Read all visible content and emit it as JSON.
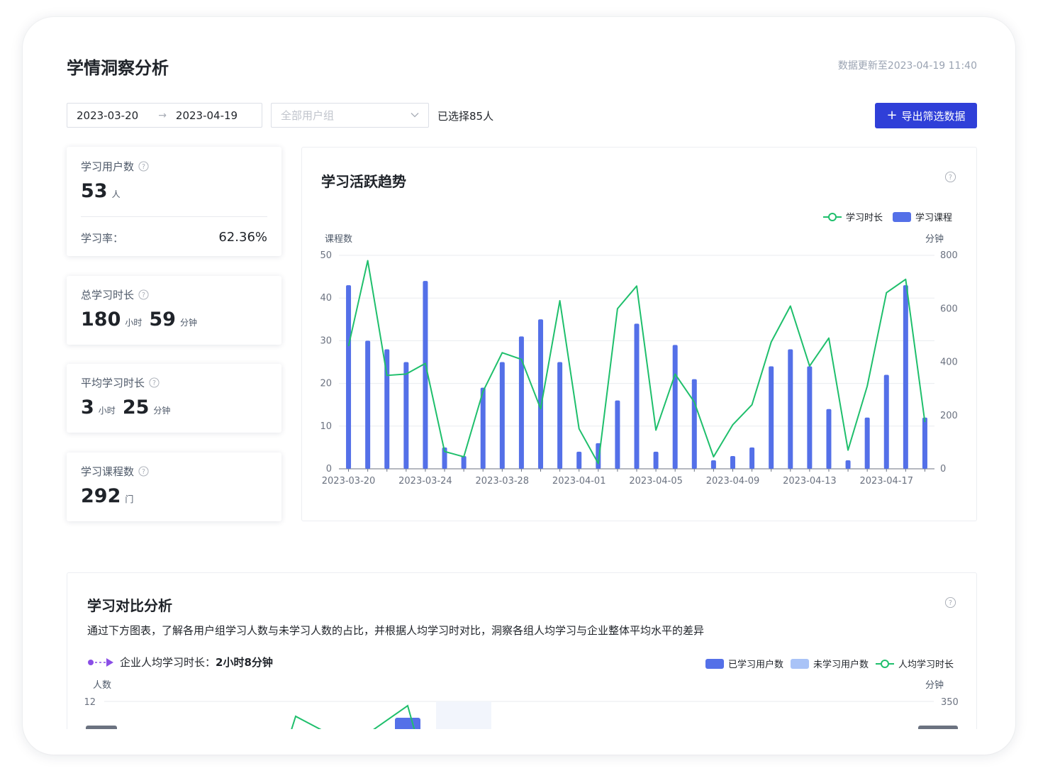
{
  "header": {
    "title": "学情洞察分析",
    "update_time": "数据更新至2023-04-19 11:40"
  },
  "filters": {
    "date_start": "2023-03-20",
    "date_arrow": "→",
    "date_end": "2023-04-19",
    "group_placeholder": "全部用户组",
    "selected_count": "已选择85人",
    "export_label": "导出筛选数据"
  },
  "stats": {
    "users": {
      "label": "学习用户数",
      "value": "53",
      "unit": "人",
      "rate_label": "学习率：",
      "rate_value": "62.36%"
    },
    "total_time": {
      "label": "总学习时长",
      "hours": "180",
      "hours_unit": "小时",
      "minutes": "59",
      "minutes_unit": "分钟"
    },
    "avg_time": {
      "label": "平均学习时长",
      "hours": "3",
      "hours_unit": "小时",
      "minutes": "25",
      "minutes_unit": "分钟"
    },
    "courses": {
      "label": "学习课程数",
      "value": "292",
      "unit": "门"
    }
  },
  "trend": {
    "title": "学习活跃趋势"
  },
  "chart_data": [
    {
      "type": "bar",
      "title": "学习活跃趋势",
      "ylabel": "课程数",
      "y2label": "分钟",
      "ylim": [
        0,
        50
      ],
      "y2lim": [
        0,
        800
      ],
      "yticks": [
        "0",
        "10",
        "20",
        "30",
        "40",
        "50"
      ],
      "y2ticks": [
        "0",
        "200",
        "400",
        "600",
        "800"
      ],
      "xticks": [
        "2023-03-20",
        "2023-03-24",
        "2023-03-28",
        "2023-04-01",
        "2023-04-05",
        "2023-04-09",
        "2023-04-13",
        "2023-04-17"
      ],
      "legend": "top-right",
      "categories": [
        "2023-03-20",
        "2023-03-21",
        "2023-03-22",
        "2023-03-23",
        "2023-03-24",
        "2023-03-25",
        "2023-03-26",
        "2023-03-27",
        "2023-03-28",
        "2023-03-29",
        "2023-03-30",
        "2023-03-31",
        "2023-04-01",
        "2023-04-02",
        "2023-04-03",
        "2023-04-04",
        "2023-04-05",
        "2023-04-06",
        "2023-04-07",
        "2023-04-08",
        "2023-04-09",
        "2023-04-10",
        "2023-04-11",
        "2023-04-12",
        "2023-04-13",
        "2023-04-14",
        "2023-04-15",
        "2023-04-16",
        "2023-04-17",
        "2023-04-18",
        "2023-04-19"
      ],
      "series": [
        {
          "name": "学习课程",
          "kind": "bar",
          "axis": "left",
          "color": "#5470e8",
          "values": [
            43,
            30,
            28,
            25,
            44,
            5,
            3,
            19,
            25,
            31,
            35,
            25,
            4,
            6,
            16,
            34,
            4,
            29,
            21,
            2,
            3,
            5,
            24,
            28,
            24,
            14,
            2,
            12,
            22,
            43,
            12
          ]
        },
        {
          "name": "学习时长",
          "kind": "line",
          "axis": "right",
          "color": "#1fbf6c",
          "values": [
            460,
            780,
            350,
            355,
            395,
            65,
            45,
            290,
            435,
            410,
            225,
            630,
            150,
            20,
            600,
            685,
            145,
            355,
            250,
            45,
            165,
            240,
            475,
            610,
            385,
            490,
            70,
            310,
            660,
            710,
            175
          ]
        }
      ]
    },
    {
      "type": "bar",
      "title": "学习对比分析",
      "ylabel": "人数",
      "y2label": "分钟",
      "yticks": [
        "12"
      ],
      "y2ticks": [
        "350"
      ],
      "legend": "top-right",
      "series": [
        {
          "name": "已学习用户数",
          "color": "#5470e8"
        },
        {
          "name": "未学习用户数",
          "color": "#a9c3f7"
        },
        {
          "name": "人均学习时长",
          "color": "#1fbf6c"
        }
      ]
    }
  ],
  "compare": {
    "title": "学习对比分析",
    "description": "通过下方图表，了解各用户组学习人数与未学习人数的占比，并根据人均学习时对比，洞察各组人均学习与企业整体平均水平的差异",
    "avg_label": "企业人均学习时长：",
    "avg_value": "2小时8分钟"
  }
}
